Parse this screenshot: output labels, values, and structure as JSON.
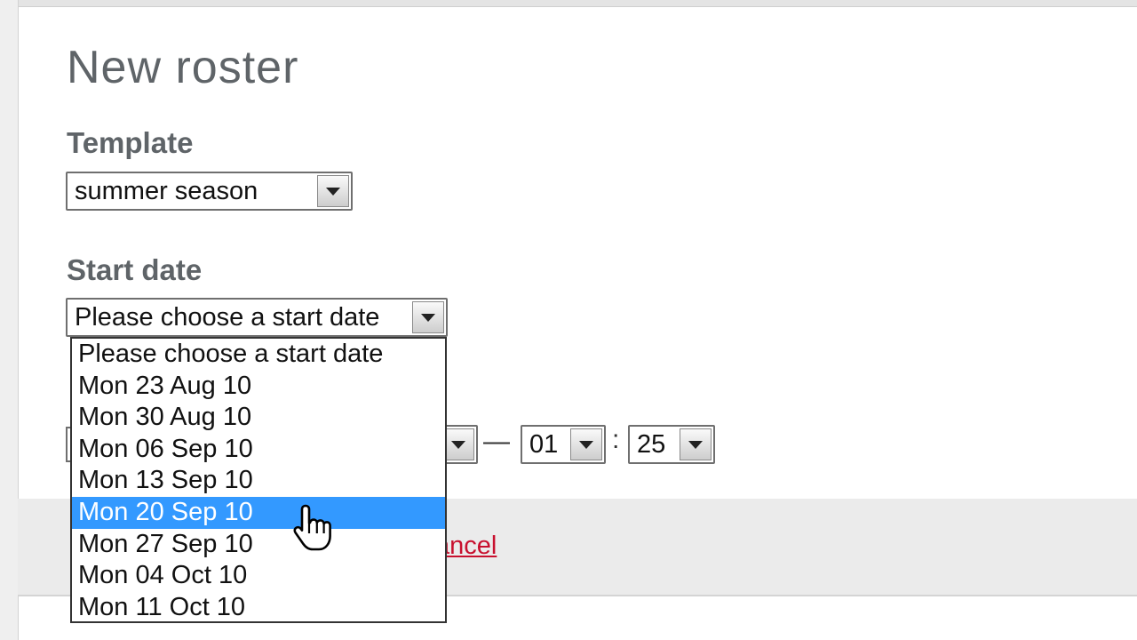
{
  "page": {
    "title": "New roster"
  },
  "template": {
    "label": "Template",
    "selected": "summer season"
  },
  "start_date": {
    "label": "Start date",
    "selected": "Please choose a start date",
    "options": [
      "Please choose a start date",
      "Mon 23 Aug 10",
      "Mon 30 Aug 10",
      "Mon 06 Sep 10",
      "Mon 13 Sep 10",
      "Mon 20 Sep 10",
      "Mon 27 Sep 10",
      "Mon 04 Oct 10",
      "Mon 11 Oct 10"
    ],
    "highlighted_index": 5
  },
  "time": {
    "separator_dash": "—",
    "separator_colon": ":",
    "hour": "01",
    "minute": "25"
  },
  "actions": {
    "cancel_label": "ancel"
  },
  "colors": {
    "highlight": "#3399ff",
    "link": "#c8102e",
    "heading": "#5f6468"
  },
  "icons": {
    "dropdown_arrow": "chevron-down-icon",
    "cursor": "hand-pointer-icon"
  }
}
